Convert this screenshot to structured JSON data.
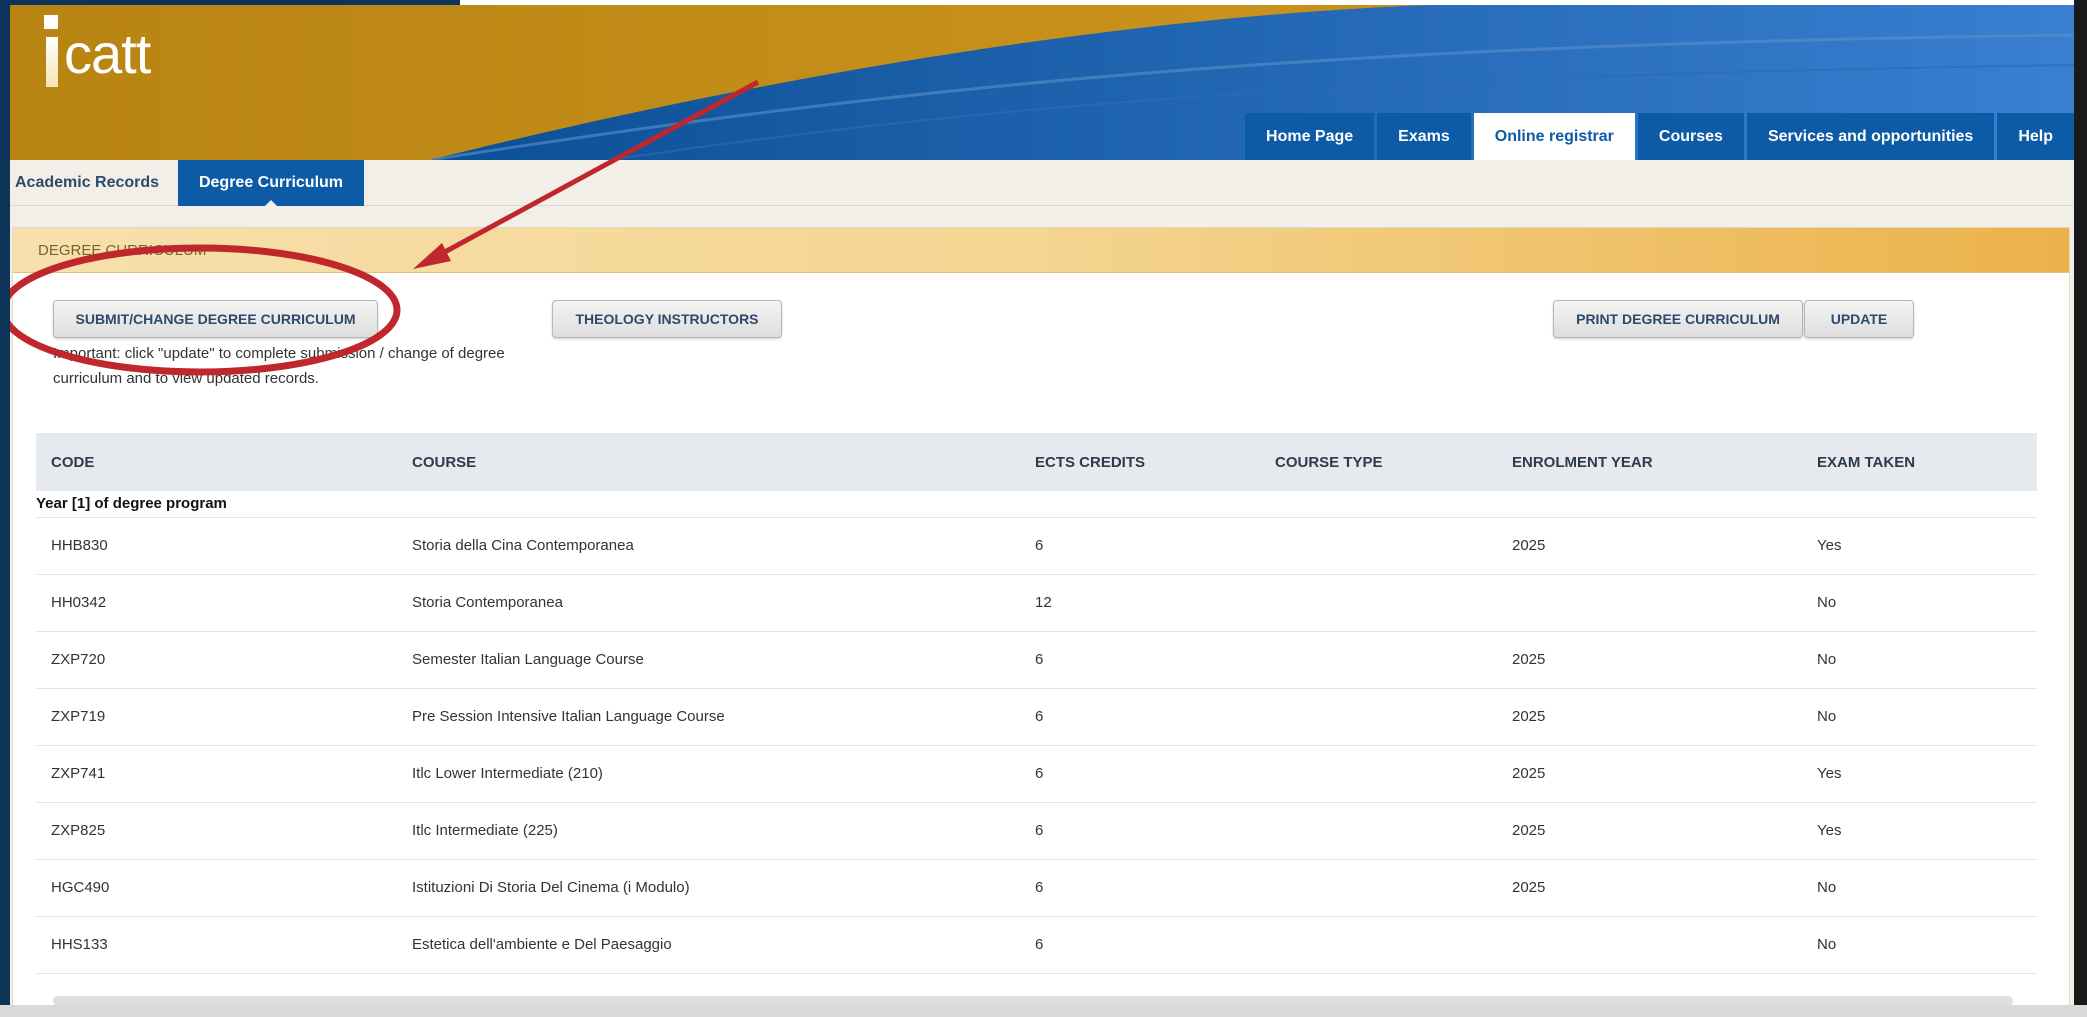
{
  "colors": {
    "header_gold": "#c18b17",
    "nav_blue": "#0d5aa6",
    "panel_header": "#f4d591",
    "annotation_red": "#c0272d"
  },
  "header": {
    "logo_text": "catt",
    "logo_icon": "i-logo-icon"
  },
  "main_nav": {
    "items": [
      {
        "label": "Home Page",
        "active": false
      },
      {
        "label": "Exams",
        "active": false
      },
      {
        "label": "Online registrar",
        "active": true
      },
      {
        "label": "Courses",
        "active": false
      },
      {
        "label": "Services and opportunities",
        "active": false
      },
      {
        "label": "Help",
        "active": false
      }
    ]
  },
  "sub_nav": {
    "items": [
      {
        "label": "Academic Records",
        "active": false
      },
      {
        "label": "Degree Curriculum",
        "active": true
      }
    ]
  },
  "panel": {
    "title": "Degree curriculum",
    "buttons": {
      "submit": "Submit/change degree curriculum",
      "theology": "Theology instructors",
      "print": "Print degree curriculum",
      "update": "Update"
    },
    "note": "Important: click \"update\" to complete submission / change of degree curriculum and to view updated records."
  },
  "table": {
    "columns": [
      "CODE",
      "COURSE",
      "ECTS CREDITS",
      "COURSE TYPE",
      "ENROLMENT YEAR",
      "EXAM TAKEN"
    ],
    "group_label": "Year [1] of degree program",
    "rows": [
      {
        "code": "HHB830",
        "course": "Storia della Cina Contemporanea",
        "ects": "6",
        "type": "",
        "year": "2025",
        "exam": "Yes"
      },
      {
        "code": "HH0342",
        "course": "Storia Contemporanea",
        "ects": "12",
        "type": "",
        "year": "",
        "exam": "No"
      },
      {
        "code": "ZXP720",
        "course": "Semester Italian Language Course",
        "ects": "6",
        "type": "",
        "year": "2025",
        "exam": "No"
      },
      {
        "code": "ZXP719",
        "course": "Pre Session Intensive Italian Language Course",
        "ects": "6",
        "type": "",
        "year": "2025",
        "exam": "No"
      },
      {
        "code": "ZXP741",
        "course": "Itlc Lower Intermediate (210)",
        "ects": "6",
        "type": "",
        "year": "2025",
        "exam": "Yes"
      },
      {
        "code": "ZXP825",
        "course": "Itlc Intermediate (225)",
        "ects": "6",
        "type": "",
        "year": "2025",
        "exam": "Yes"
      },
      {
        "code": "HGC490",
        "course": "Istituzioni Di Storia Del Cinema (i Modulo)",
        "ects": "6",
        "type": "",
        "year": "2025",
        "exam": "No"
      },
      {
        "code": "HHS133",
        "course": "Estetica dell'ambiente e Del Paesaggio",
        "ects": "6",
        "type": "",
        "year": "",
        "exam": "No"
      }
    ]
  }
}
